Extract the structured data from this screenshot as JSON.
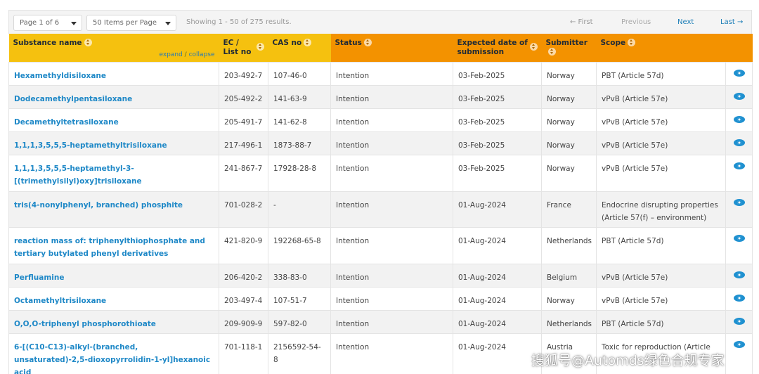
{
  "pagination": {
    "page_select": "Page 1 of 6",
    "items_select": "50 Items per Page",
    "showing": "Showing 1 - 50 of 275 results.",
    "first": "← First",
    "previous": "Previous",
    "next": "Next",
    "last": "Last →"
  },
  "table": {
    "headers": {
      "substance_name": "Substance name",
      "expand": "expand",
      "expand_sep": " / ",
      "collapse": "collapse",
      "ec_line1": "EC /",
      "ec_line2": "List no",
      "cas": "CAS no",
      "status": "Status",
      "date_line1": "Expected date of",
      "date_line2": "submission",
      "submitter": "Submitter",
      "scope": "Scope"
    },
    "rows": [
      {
        "name": "Hexamethyldisiloxane",
        "ec": "203-492-7",
        "cas": "107-46-0",
        "status": "Intention",
        "date": "03-Feb-2025",
        "submitter": "Norway",
        "scope": "PBT (Article 57d)"
      },
      {
        "name": "Dodecamethylpentasiloxane",
        "ec": "205-492-2",
        "cas": "141-63-9",
        "status": "Intention",
        "date": "03-Feb-2025",
        "submitter": "Norway",
        "scope": "vPvB (Article 57e)"
      },
      {
        "name": "Decamethyltetrasiloxane",
        "ec": "205-491-7",
        "cas": "141-62-8",
        "status": "Intention",
        "date": "03-Feb-2025",
        "submitter": "Norway",
        "scope": "vPvB (Article 57e)"
      },
      {
        "name": "1,1,1,3,5,5,5-heptamethyltrisiloxane",
        "ec": "217-496-1",
        "cas": "1873-88-7",
        "status": "Intention",
        "date": "03-Feb-2025",
        "submitter": "Norway",
        "scope": "vPvB (Article 57e)"
      },
      {
        "name": "1,1,1,3,5,5,5-heptamethyl-3-[(trimethylsilyl)oxy]trisiloxane",
        "ec": "241-867-7",
        "cas": "17928-28-8",
        "status": "Intention",
        "date": "03-Feb-2025",
        "submitter": "Norway",
        "scope": "vPvB (Article 57e)"
      },
      {
        "name": "tris(4-nonylphenyl, branched) phosphite",
        "ec": "701-028-2",
        "cas": "-",
        "status": "Intention",
        "date": "01-Aug-2024",
        "submitter": "France",
        "scope": "Endocrine disrupting properties (Article 57(f) – environment)"
      },
      {
        "name": "reaction mass of: triphenylthiophosphate and tertiary butylated phenyl derivatives",
        "ec": "421-820-9",
        "cas": "192268-65-8",
        "status": "Intention",
        "date": "01-Aug-2024",
        "submitter": "Netherlands",
        "scope": "PBT (Article 57d)"
      },
      {
        "name": "Perfluamine",
        "ec": "206-420-2",
        "cas": "338-83-0",
        "status": "Intention",
        "date": "01-Aug-2024",
        "submitter": "Belgium",
        "scope": "vPvB (Article 57e)"
      },
      {
        "name": "Octamethyltrisiloxane",
        "ec": "203-497-4",
        "cas": "107-51-7",
        "status": "Intention",
        "date": "01-Aug-2024",
        "submitter": "Norway",
        "scope": "vPvB (Article 57e)"
      },
      {
        "name": "O,O,O-triphenyl phosphorothioate",
        "ec": "209-909-9",
        "cas": "597-82-0",
        "status": "Intention",
        "date": "01-Aug-2024",
        "submitter": "Netherlands",
        "scope": "PBT (Article 57d)"
      },
      {
        "name": "6-[(C10-C13)-alkyl-(branched, unsaturated)-2,5-dioxopyrrolidin-1-yl]hexanoic acid",
        "ec": "701-118-1",
        "cas": "2156592-54-8",
        "status": "Intention",
        "date": "01-Aug-2024",
        "submitter": "Austria",
        "scope": "Toxic for reproduction (Article"
      }
    ]
  },
  "watermark": "搜狐号@Automds绿色合规专家",
  "colors": {
    "header_yellow": "#f5c10f",
    "header_orange": "#f39200",
    "link_blue": "#1e88c7",
    "row_alt": "#f2f2f2"
  },
  "icons": {
    "row_action": "eye-icon",
    "sort": "sort-icon",
    "select": "chevron-down-icon"
  }
}
